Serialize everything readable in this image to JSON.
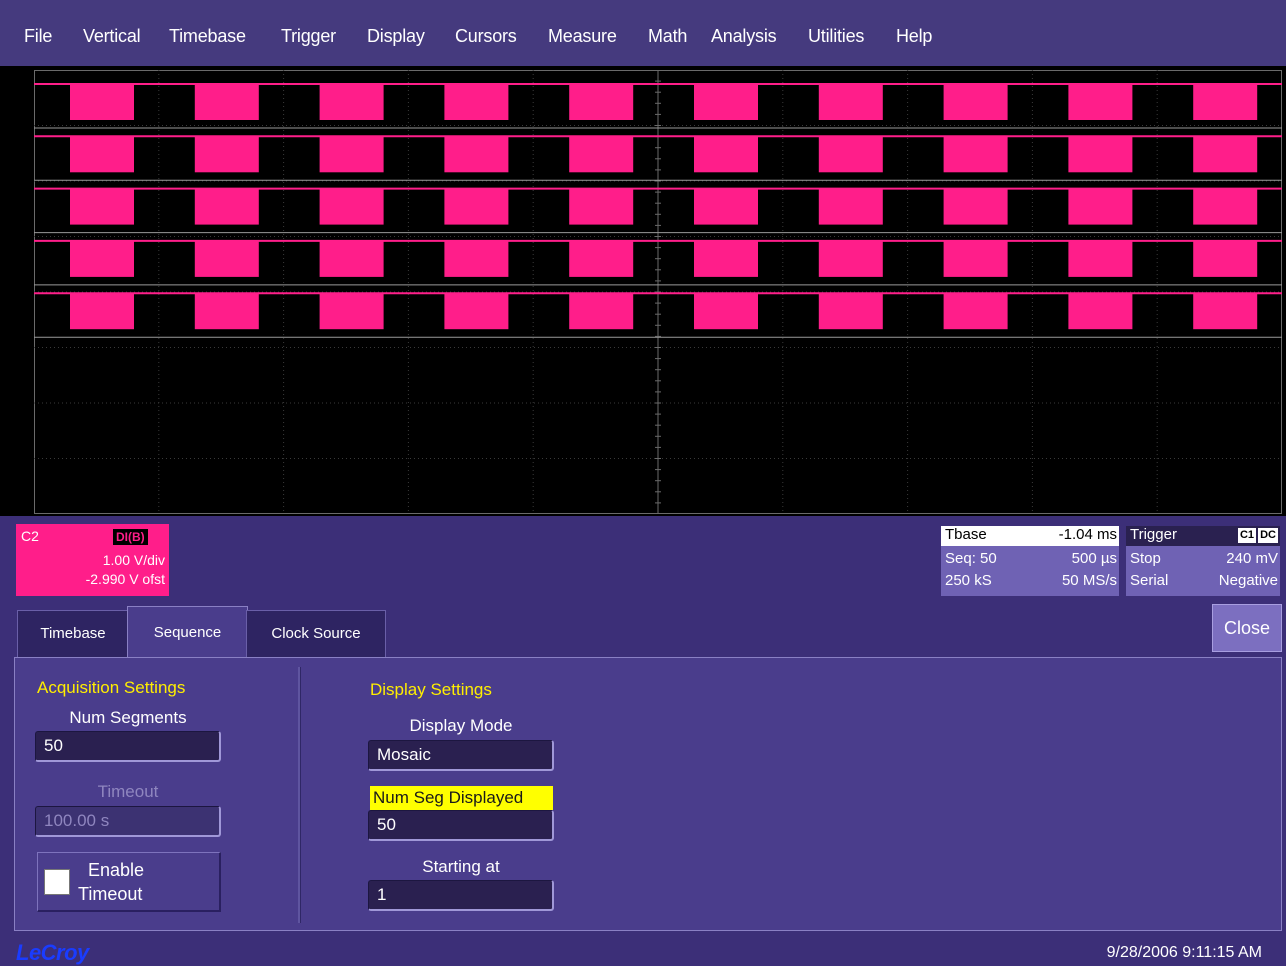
{
  "menu": [
    "File",
    "Vertical",
    "Timebase",
    "Trigger",
    "Display",
    "Cursors",
    "Measure",
    "Math",
    "Analysis",
    "Utilities",
    "Help"
  ],
  "waveform": {
    "color": "#ff1e8a",
    "visible_segments": 5,
    "pulses_per_segment": 10
  },
  "channel": {
    "name": "C2",
    "badge": "DI(B)",
    "vdiv": "1.00 V/div",
    "offset": "-2.990 V ofst",
    "color": "#ff1e8a"
  },
  "timebase": {
    "title": "Tbase",
    "delay": "-1.04 ms",
    "seq": "Seq: 50",
    "time_div": "500 µs",
    "samples": "250 kS",
    "rate": "50 MS/s"
  },
  "trigger": {
    "title": "Trigger",
    "badge_source": "C1",
    "badge_coupling": "DC",
    "mode": "Stop",
    "level": "240 mV",
    "type": "Serial",
    "slope": "Negative"
  },
  "tabs": [
    {
      "label": "Timebase",
      "active": false
    },
    {
      "label": "Sequence",
      "active": true
    },
    {
      "label": "Clock Source",
      "active": false
    }
  ],
  "close_label": "Close",
  "acquisition": {
    "title": "Acquisition Settings",
    "num_segments_label": "Num Segments",
    "num_segments_value": "50",
    "timeout_label": "Timeout",
    "timeout_value": "100.00 s",
    "enable_timeout_line1": "Enable",
    "enable_timeout_line2": "Timeout",
    "enable_timeout_checked": false
  },
  "display_settings": {
    "title": "Display Settings",
    "display_mode_label": "Display Mode",
    "display_mode_value": "Mosaic",
    "num_seg_displayed_label": "Num Seg Displayed",
    "num_seg_displayed_value": "50",
    "starting_at_label": "Starting at",
    "starting_at_value": "1"
  },
  "footer": {
    "logo": "LeCroy",
    "datetime": "9/28/2006 9:11:15 AM"
  }
}
